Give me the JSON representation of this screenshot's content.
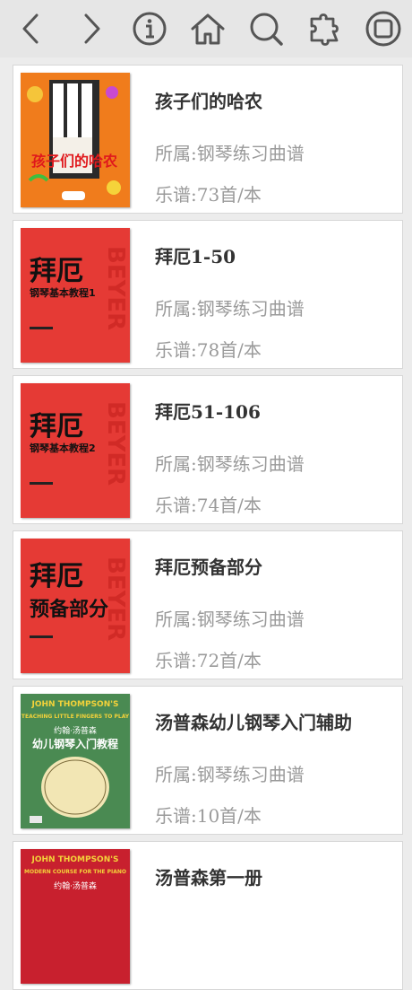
{
  "toolbar": {
    "icons": [
      "back-arrow-icon",
      "forward-arrow-icon",
      "info-icon",
      "home-icon",
      "search-icon",
      "puzzle-icon",
      "stop-icon"
    ]
  },
  "books": [
    {
      "title": "孩子们的哈农",
      "category": "所属:钢琴练习曲谱",
      "count": "乐谱:73首/本",
      "cover_text": "孩子们的哈农"
    },
    {
      "title": "拜厄1-50",
      "category": "所属:钢琴练习曲谱",
      "count": "乐谱:78首/本",
      "cover_text": "拜厄",
      "cover_sub": "钢琴基本教程1",
      "cover_side": "BEYER"
    },
    {
      "title": "拜厄51-106",
      "category": "所属:钢琴练习曲谱",
      "count": "乐谱:74首/本",
      "cover_text": "拜厄",
      "cover_sub": "钢琴基本教程2",
      "cover_side": "BEYER"
    },
    {
      "title": "拜厄预备部分",
      "category": "所属:钢琴练习曲谱",
      "count": "乐谱:72首/本",
      "cover_text": "拜厄",
      "cover_sub": "预备部分",
      "cover_side": "BEYER"
    },
    {
      "title": "汤普森幼儿钢琴入门辅助",
      "category": "所属:钢琴练习曲谱",
      "count": "乐谱:10首/本",
      "cover_text": "JOHN THOMPSON'S",
      "cover_sub": "TEACHING LITTLE FINGERS TO PLAY",
      "cover_cn": "约翰·汤普森",
      "cover_cn2": "幼儿钢琴入门教程"
    },
    {
      "title": "汤普森第一册",
      "category": "",
      "count": "",
      "cover_text": "JOHN THOMPSON'S",
      "cover_sub": "MODERN COURSE FOR THE PIANO",
      "cover_cn": "约翰·汤普森"
    }
  ],
  "colors": {
    "toolbar": "#e6e6e6",
    "title": "#333333",
    "meta": "#9a9a9a",
    "orange": "#f07c1c",
    "red": "#e53a35",
    "green": "#4a8a52",
    "crimson": "#c8202e"
  }
}
